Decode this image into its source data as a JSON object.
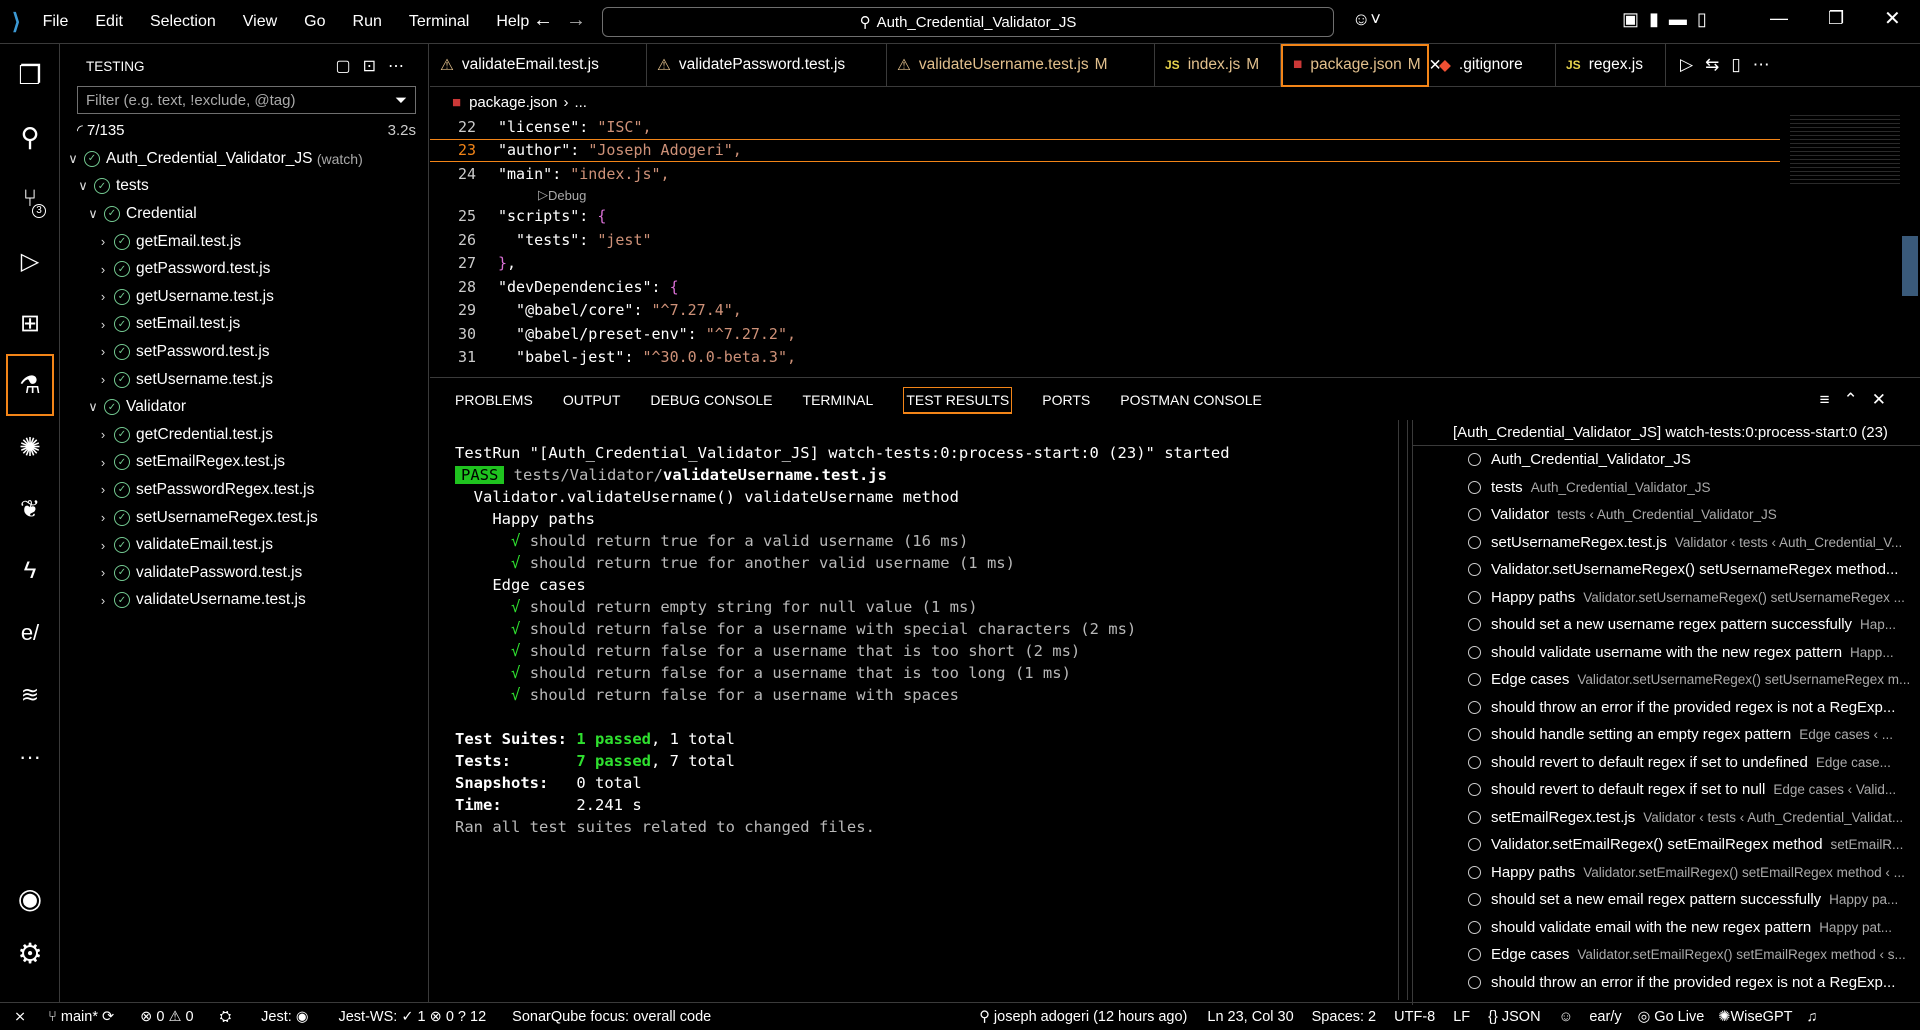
{
  "titlebar": {
    "menus": [
      "File",
      "Edit",
      "Selection",
      "View",
      "Go",
      "Run",
      "Terminal",
      "Help"
    ],
    "search": "Auth_Credential_Validator_JS"
  },
  "activity": {
    "source_control_badge": "3"
  },
  "sidebar": {
    "title": "TESTING",
    "filter_placeholder": "Filter (e.g. text, !exclude, @tag)",
    "count": "7/135",
    "time": "3.2s",
    "root": "Auth_Credential_Validator_JS",
    "root_suffix": "(watch)",
    "tests": "tests",
    "credential": "Credential",
    "credential_items": [
      "getEmail.test.js",
      "getPassword.test.js",
      "getUsername.test.js",
      "setEmail.test.js",
      "setPassword.test.js",
      "setUsername.test.js"
    ],
    "validator": "Validator",
    "validator_items": [
      "getCredential.test.js",
      "setEmailRegex.test.js",
      "setPasswordRegex.test.js",
      "setUsernameRegex.test.js",
      "validateEmail.test.js",
      "validatePassword.test.js",
      "validateUsername.test.js"
    ]
  },
  "tabs": [
    {
      "label": "validateEmail.test.js",
      "mod": ""
    },
    {
      "label": "validatePassword.test.js",
      "mod": ""
    },
    {
      "label": "validateUsername.test.js",
      "mod": "M"
    },
    {
      "label": "index.js",
      "mod": "M"
    },
    {
      "label": "package.json",
      "mod": "M"
    },
    {
      "label": ".gitignore",
      "mod": ""
    },
    {
      "label": "regex.js",
      "mod": ""
    }
  ],
  "breadcrumb": {
    "file": "package.json",
    "more": "..."
  },
  "editor": {
    "codelens": "Debug",
    "lines": [
      {
        "n": "22",
        "key": "\"license\"",
        "val": "\"ISC\","
      },
      {
        "n": "23",
        "key": "\"author\"",
        "val": "\"Joseph Adogeri\","
      },
      {
        "n": "24",
        "key": "\"main\"",
        "val": "\"index.js\","
      },
      {
        "n": "25",
        "key": "\"scripts\"",
        "val": "{"
      },
      {
        "n": "26",
        "key": "  \"tests\"",
        "val": "\"jest\""
      },
      {
        "n": "27",
        "key": "}",
        "val": ","
      },
      {
        "n": "28",
        "key": "\"devDependencies\"",
        "val": "{"
      },
      {
        "n": "29",
        "key": "  \"@babel/core\"",
        "val": "\"^7.27.4\","
      },
      {
        "n": "30",
        "key": "  \"@babel/preset-env\"",
        "val": "\"^7.27.2\","
      },
      {
        "n": "31",
        "key": "  \"babel-jest\"",
        "val": "\"^30.0.0-beta.3\","
      }
    ]
  },
  "panel_tabs": [
    "PROBLEMS",
    "OUTPUT",
    "DEBUG CONSOLE",
    "TERMINAL",
    "TEST RESULTS",
    "PORTS",
    "POSTMAN CONSOLE"
  ],
  "terminal": {
    "run": "TestRun \"[Auth_Credential_Validator_JS] watch-tests:0:process-start:0 (23)\" started",
    "pass": "PASS",
    "path_dir": "tests/Validator/",
    "path_file": "validateUsername.test.js",
    "describe": "  Validator.validateUsername() validateUsername method",
    "happy": "    Happy paths",
    "happy_tests": [
      "should return true for a valid username (16 ms)",
      "should return true for another valid username (1 ms)"
    ],
    "edge": "    Edge cases",
    "edge_tests": [
      "should return empty string for null value (1 ms)",
      "should return false for a username with special characters (2 ms)",
      "should return false for a username that is too short (2 ms)",
      "should return false for a username that is too long (1 ms)",
      "should return false for a username with spaces"
    ],
    "suites_label": "Test Suites:",
    "suites_passed": "1 passed",
    "suites_total": ", 1 total",
    "tests_label": "Tests:",
    "tests_passed": "7 passed",
    "tests_total": ", 7 total",
    "snap_label": "Snapshots:",
    "snap_val": "0 total",
    "time_label": "Time:",
    "time_val": "2.241 s",
    "ran": "Ran all test suites related to changed files."
  },
  "results": {
    "header": "[Auth_Credential_Validator_JS] watch-tests:0:process-start:0 (23)",
    "items": [
      {
        "t": "Auth_Credential_Validator_JS",
        "s": ""
      },
      {
        "t": "tests",
        "s": "Auth_Credential_Validator_JS"
      },
      {
        "t": "Validator",
        "s": "tests ‹ Auth_Credential_Validator_JS"
      },
      {
        "t": "setUsernameRegex.test.js",
        "s": "Validator ‹ tests ‹ Auth_Credential_V..."
      },
      {
        "t": "Validator.setUsernameRegex() setUsernameRegex method...",
        "s": ""
      },
      {
        "t": "Happy paths",
        "s": "Validator.setUsernameRegex() setUsernameRegex ..."
      },
      {
        "t": "should set a new username regex pattern successfully",
        "s": "Hap..."
      },
      {
        "t": "should validate username with the new regex pattern",
        "s": "Happ..."
      },
      {
        "t": "Edge cases",
        "s": "Validator.setUsernameRegex() setUsernameRegex m..."
      },
      {
        "t": "should throw an error if the provided regex is not a RegExp...",
        "s": ""
      },
      {
        "t": "should handle setting an empty regex pattern",
        "s": "Edge cases ‹ ..."
      },
      {
        "t": "should revert to default regex if set to undefined",
        "s": "Edge case..."
      },
      {
        "t": "should revert to default regex if set to null",
        "s": "Edge cases ‹ Valid..."
      },
      {
        "t": "setEmailRegex.test.js",
        "s": "Validator ‹ tests ‹ Auth_Credential_Validat..."
      },
      {
        "t": "Validator.setEmailRegex() setEmailRegex method",
        "s": "setEmailR..."
      },
      {
        "t": "Happy paths",
        "s": "Validator.setEmailRegex() setEmailRegex method ‹ ..."
      },
      {
        "t": "should set a new email regex pattern successfully",
        "s": "Happy pa..."
      },
      {
        "t": "should validate email with the new regex pattern",
        "s": "Happy pat..."
      },
      {
        "t": "Edge cases",
        "s": "Validator.setEmailRegex() setEmailRegex method ‹ s..."
      },
      {
        "t": "should throw an error if the provided regex is not a RegExp...",
        "s": ""
      }
    ]
  },
  "status": {
    "branch": "main*",
    "errors": "0",
    "warnings": "0",
    "jest": "Jest:",
    "jestws": "Jest-WS:",
    "jestws_pass": "1",
    "jestws_fail": "0",
    "jestws_skip": "12",
    "sonar": "SonarQube focus: overall code",
    "blame": "joseph adogeri (12 hours ago)",
    "pos": "Ln 23, Col 30",
    "spaces": "Spaces: 2",
    "enc": "UTF-8",
    "eol": "LF",
    "lang": "JSON",
    "earl": "ear/y",
    "golive": "Go Live",
    "wise": "WiseGPT"
  }
}
